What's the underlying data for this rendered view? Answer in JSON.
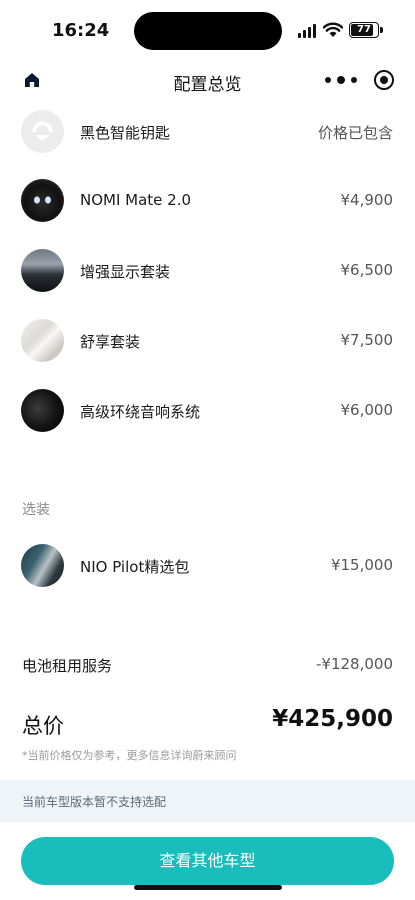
{
  "status_bar": {
    "time": "16:24",
    "battery": "77",
    "battery_level": 0.77
  },
  "header": {
    "title": "配置总览"
  },
  "items": [
    {
      "name": "黑色智能钥匙",
      "price": "价格已包含",
      "thumb": "smart-key"
    },
    {
      "name": "NOMI Mate 2.0",
      "price": "¥4,900",
      "thumb": "nomi"
    },
    {
      "name": "增强显示套装",
      "price": "¥6,500",
      "thumb": "hud"
    },
    {
      "name": "舒享套装",
      "price": "¥7,500",
      "thumb": "comfort"
    },
    {
      "name": "高级环绕音响系统",
      "price": "¥6,000",
      "thumb": "audio"
    }
  ],
  "optional_section": {
    "label": "选装",
    "items": [
      {
        "name": "NIO Pilot精选包",
        "price": "¥15,000",
        "thumb": "pilot"
      }
    ]
  },
  "battery_service": {
    "label": "电池租用服务",
    "value": "-¥128,000"
  },
  "total": {
    "label": "总价",
    "value": "¥425,900"
  },
  "disclaimer": "*当前价格仅为参考，更多信息详询蔚来顾问",
  "notice": "当前车型版本暂不支持选配",
  "cta": {
    "label": "查看其他车型"
  },
  "colors": {
    "accent": "#19bdbb",
    "notice_bg": "#eef4f8"
  }
}
